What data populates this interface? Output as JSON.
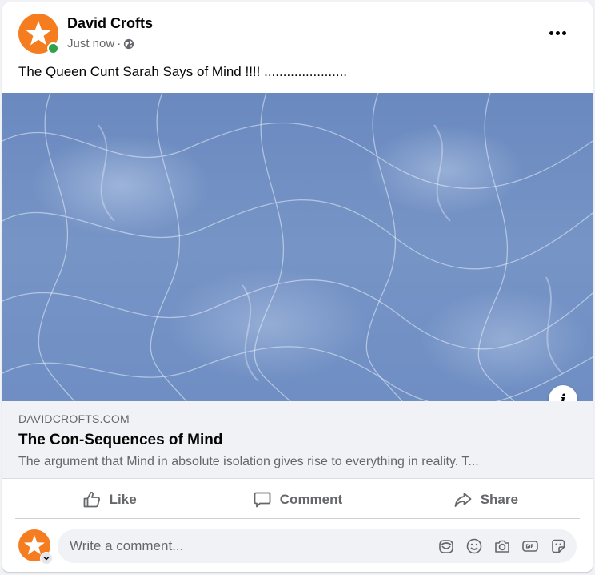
{
  "post": {
    "author": "David Crofts",
    "time": "Just now",
    "separator": "·",
    "privacy_icon": "globe-icon",
    "text": "The Queen Cunt Sarah Says of Mind !!!! ......................",
    "more_icon": "more-options-icon"
  },
  "link_preview": {
    "domain": "DAVIDCROFTS.COM",
    "title": "The Con-Sequences of Mind",
    "description": "The argument that Mind in absolute isolation gives rise to everything in reality. T...",
    "info_icon": "i"
  },
  "actions": {
    "like": "Like",
    "comment": "Comment",
    "share": "Share"
  },
  "comment_box": {
    "placeholder": "Write a comment...",
    "icons": [
      "avatar-sticker-icon",
      "emoji-icon",
      "camera-icon",
      "gif-icon",
      "sticker-icon"
    ]
  },
  "colors": {
    "brand_orange": "#f57c1f",
    "online_green": "#31a24c",
    "secondary_text": "#65676b",
    "link_box_bg": "#f0f2f5"
  }
}
